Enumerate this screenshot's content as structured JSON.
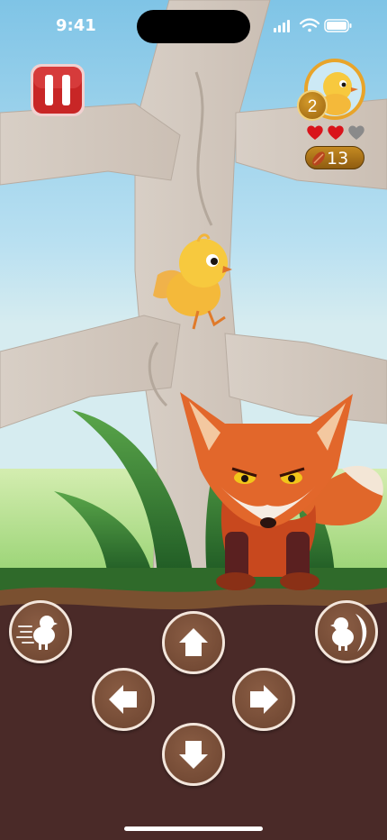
{
  "status_bar": {
    "time": "9:41"
  },
  "hud": {
    "level": "2",
    "hearts": [
      {
        "state": "full",
        "color": "#d9141b"
      },
      {
        "state": "full",
        "color": "#d9141b"
      },
      {
        "state": "empty",
        "color": "#8a8a8a"
      }
    ],
    "seed_count": "13"
  },
  "controls": {
    "dash": {
      "icon": "dash-chick-icon"
    },
    "up": {
      "icon": "arrow-up-icon"
    },
    "left": {
      "icon": "arrow-left-icon"
    },
    "right": {
      "icon": "arrow-right-icon"
    },
    "down": {
      "icon": "arrow-down-icon"
    },
    "fly": {
      "icon": "wing-chick-icon"
    }
  },
  "colors": {
    "sky": "#bde1f2",
    "ground": "#4a2a28",
    "pause_red": "#cc2a2a",
    "accent_gold": "#c48a22"
  }
}
